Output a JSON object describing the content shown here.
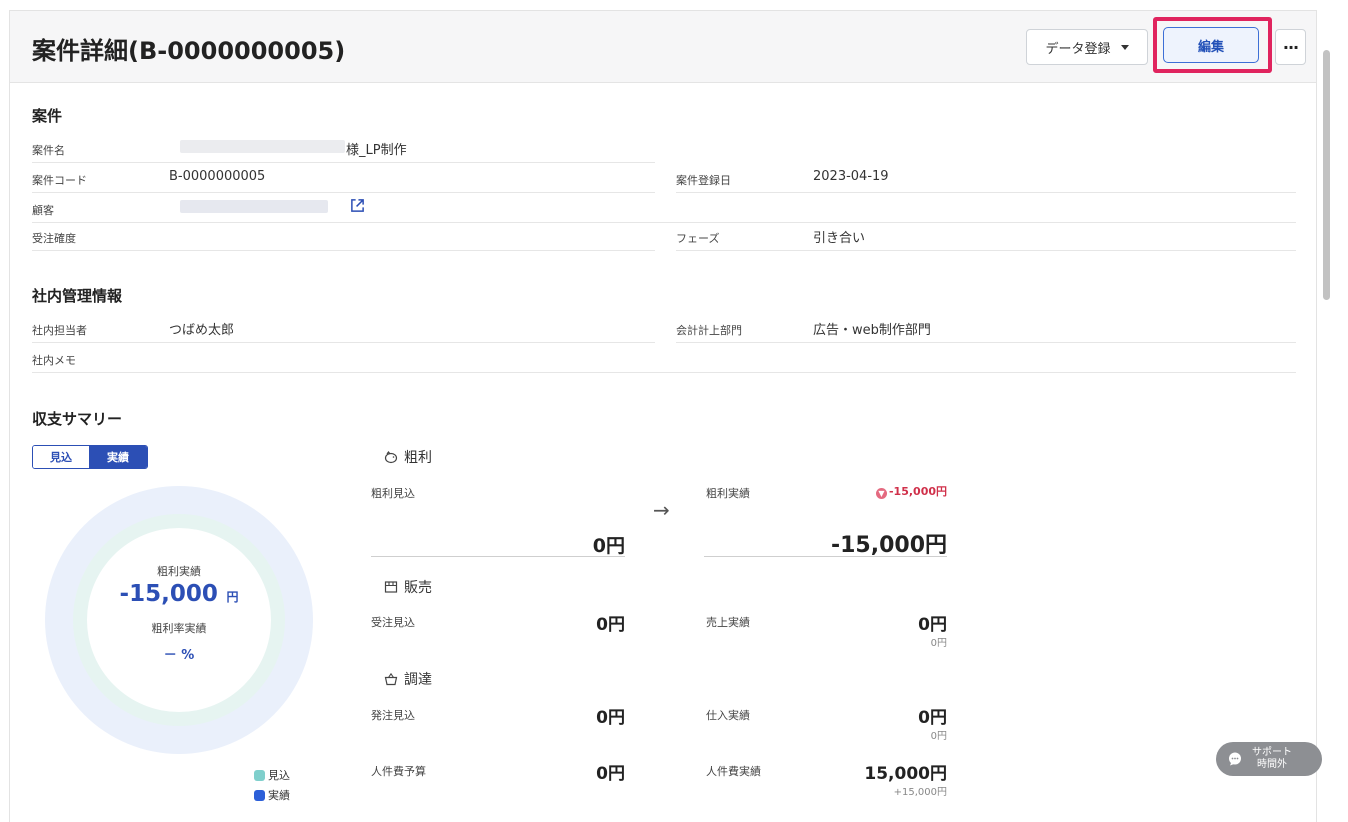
{
  "header": {
    "title": "案件詳細(B-0000000005)",
    "data_register_label": "データ登録",
    "edit_label": "編集",
    "more_label": "···"
  },
  "project": {
    "section_title": "案件",
    "name_label": "案件名",
    "name_value": "様_LP制作",
    "code_label": "案件コード",
    "code_value": "B-0000000005",
    "registered_label": "案件登録日",
    "registered_value": "2023-04-19",
    "customer_label": "顧客",
    "probability_label": "受注確度",
    "phase_label": "フェーズ",
    "phase_value": "引き合い"
  },
  "internal": {
    "section_title": "社内管理情報",
    "owner_label": "社内担当者",
    "owner_value": "つばめ太郎",
    "dept_label": "会計計上部門",
    "dept_value": "広告・web制作部門",
    "memo_label": "社内メモ"
  },
  "summary": {
    "section_title": "収支サマリー",
    "toggle": {
      "forecast": "見込",
      "actual": "実績",
      "selected": "実績"
    },
    "donut": {
      "gross_label": "粗利実績",
      "gross_value": "-15,000",
      "gross_unit": "円",
      "rate_label": "粗利率実績",
      "rate_value": "－ %"
    },
    "legend": [
      {
        "label": "見込",
        "color": "#7fcfcc"
      },
      {
        "label": "実績",
        "color": "#2c5fd8"
      }
    ],
    "gross": {
      "title": "粗利",
      "forecast_label": "粗利見込",
      "forecast_value": "0円",
      "actual_label": "粗利実績",
      "actual_value": "-15,000円",
      "diff_value": "-15,000円"
    },
    "sales": {
      "title": "販売",
      "forecast_label": "受注見込",
      "forecast_value": "0円",
      "actual_label": "売上実績",
      "actual_value": "0円",
      "actual_sub": "0円"
    },
    "procurement": {
      "title": "調達",
      "forecast_label": "発注見込",
      "forecast_value": "0円",
      "actual_label": "仕入実績",
      "actual_value": "0円",
      "actual_sub": "0円"
    },
    "labor": {
      "forecast_label": "人件費予算",
      "forecast_value": "0円",
      "actual_label": "人件費実績",
      "actual_value": "15,000円",
      "actual_sub": "+15,000円"
    },
    "arrow": "→"
  },
  "support": {
    "line1": "サポート",
    "line2": "時間外"
  },
  "colors": {
    "accent": "#2c4fb5",
    "highlight": "#e0245e",
    "negative": "#d0304a"
  }
}
